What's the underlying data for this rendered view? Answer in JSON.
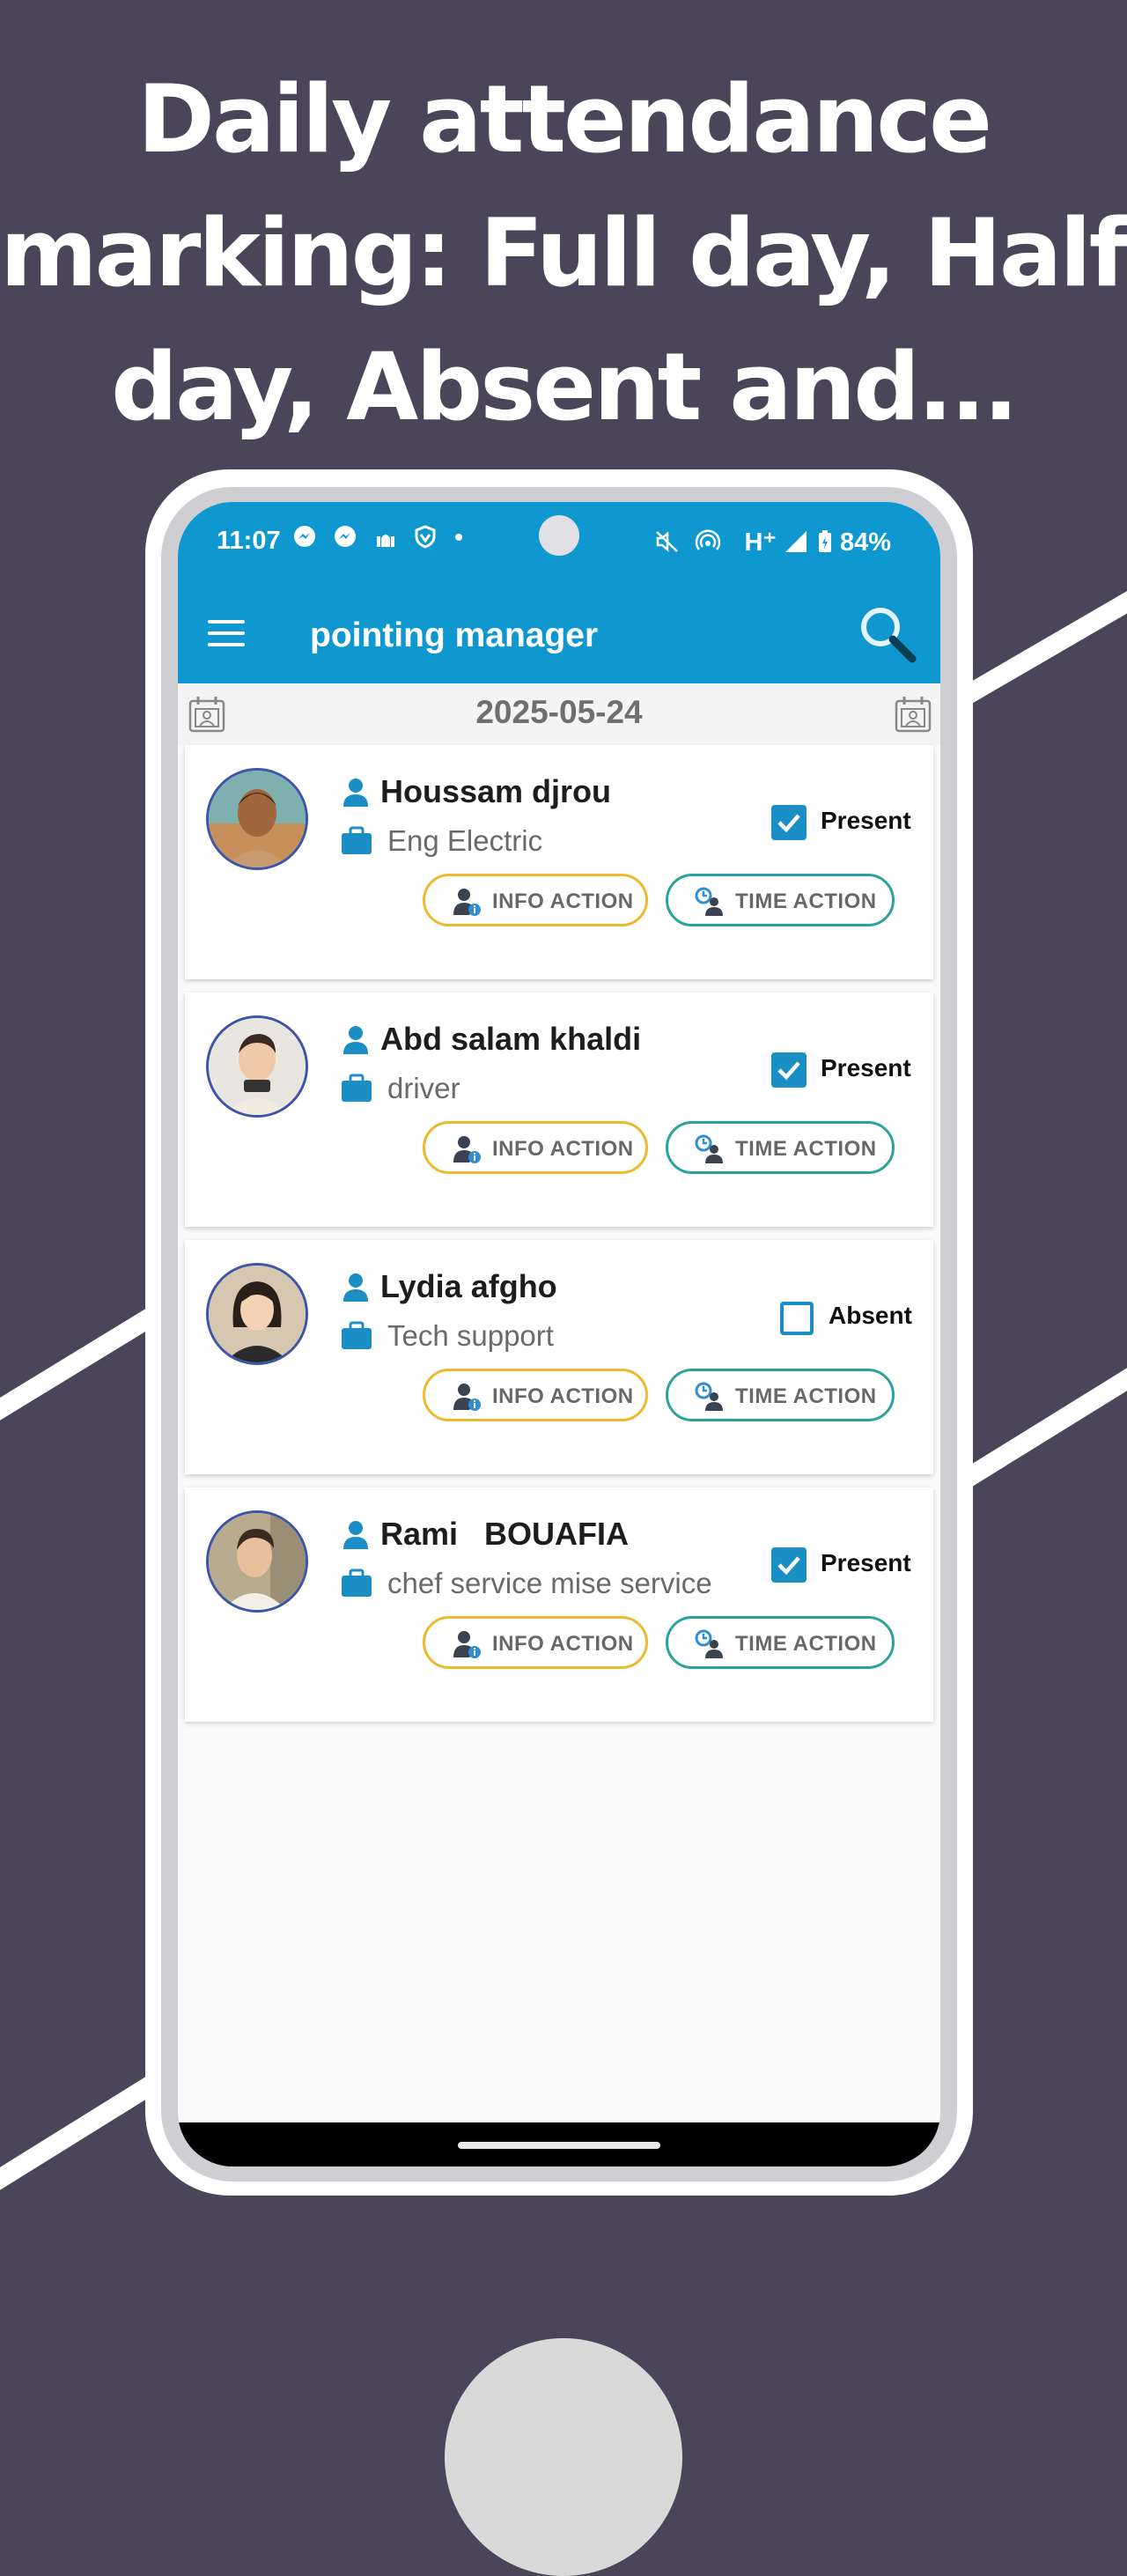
{
  "headline": {
    "line1": "Daily attendance",
    "line2": "marking: Full day, Half",
    "line3": "day, Absent and..."
  },
  "status_bar": {
    "time": "11:07",
    "network": "H⁺",
    "battery": "84%"
  },
  "app_bar": {
    "title": "pointing manager"
  },
  "date_bar": {
    "date": "2025-05-24"
  },
  "buttons": {
    "info_action": "INFO ACTION",
    "time_action": "TIME ACTION"
  },
  "employees": [
    {
      "name": "Houssam djrou",
      "role": "Eng Electric",
      "status": "Present",
      "checked": true
    },
    {
      "name": "Abd salam khaldi",
      "role": "driver",
      "status": "Present",
      "checked": true
    },
    {
      "name": "Lydia afgho",
      "role": "Tech support",
      "status": "Absent",
      "checked": false
    },
    {
      "name": "Rami   BOUAFIA",
      "role": "chef service mise service",
      "status": "Present",
      "checked": true
    }
  ],
  "colors": {
    "background": "#4a4558",
    "app_bar": "#0f98cf",
    "checkbox": "#1b8fc5",
    "info_border": "#efb92e",
    "time_border": "#2aa3a0",
    "avatar_border": "#3b55a8"
  },
  "icons": {
    "menu": "hamburger-menu-icon",
    "search": "search-icon",
    "calendar": "calendar-contact-icon",
    "person": "person-icon",
    "briefcase": "briefcase-icon",
    "info_user": "user-info-icon",
    "time_user": "user-clock-icon"
  }
}
